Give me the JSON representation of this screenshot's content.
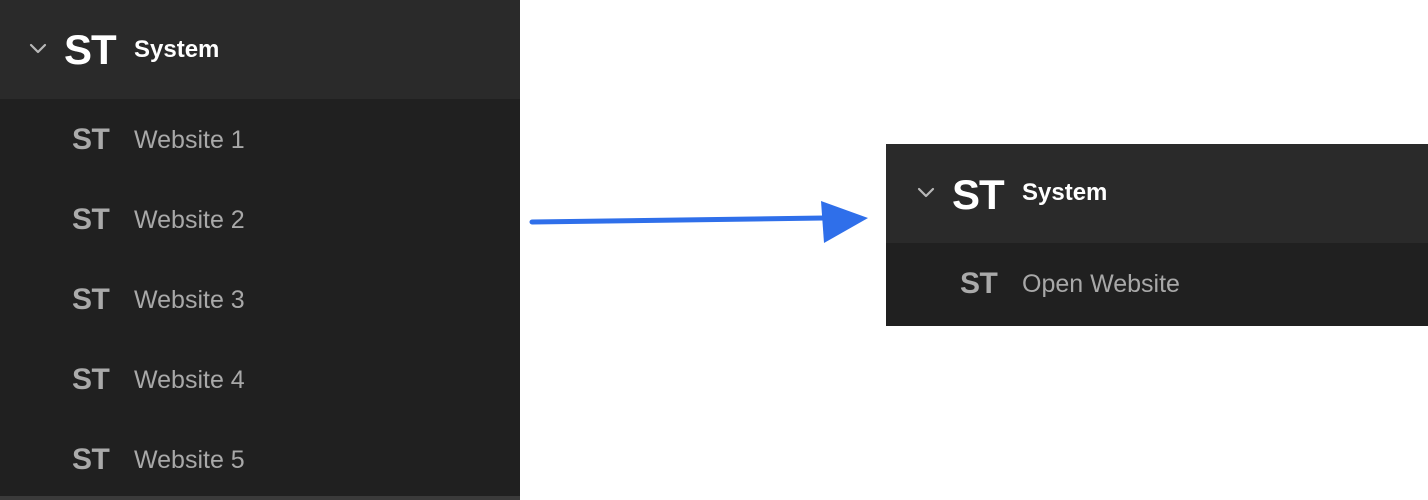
{
  "before": {
    "group": {
      "logo": "ST",
      "title": "System",
      "expand_icon": "chevron-down-icon"
    },
    "items": [
      {
        "logo": "ST",
        "label": "Website 1"
      },
      {
        "logo": "ST",
        "label": "Website 2"
      },
      {
        "logo": "ST",
        "label": "Website 3"
      },
      {
        "logo": "ST",
        "label": "Website 4"
      },
      {
        "logo": "ST",
        "label": "Website 5"
      }
    ]
  },
  "transition": {
    "icon": "arrow-right-icon",
    "color": "#2f6fea"
  },
  "after": {
    "group": {
      "logo": "ST",
      "title": "System",
      "expand_icon": "chevron-down-icon"
    },
    "items": [
      {
        "logo": "ST",
        "label": "Open Website"
      }
    ]
  },
  "colors": {
    "panel_bg": "#202020",
    "header_bg": "#2a2a2a",
    "title_text": "#ffffff",
    "item_text": "#a8a8a8"
  }
}
